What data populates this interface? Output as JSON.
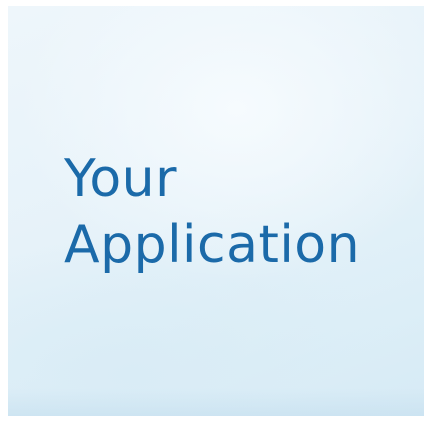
{
  "card": {
    "title_line_1": "Your",
    "title_line_2": "Application"
  },
  "colors": {
    "title_text": "#1b6aa9",
    "background_light": "#eef6fb",
    "background_dark": "#d6eaf5"
  }
}
